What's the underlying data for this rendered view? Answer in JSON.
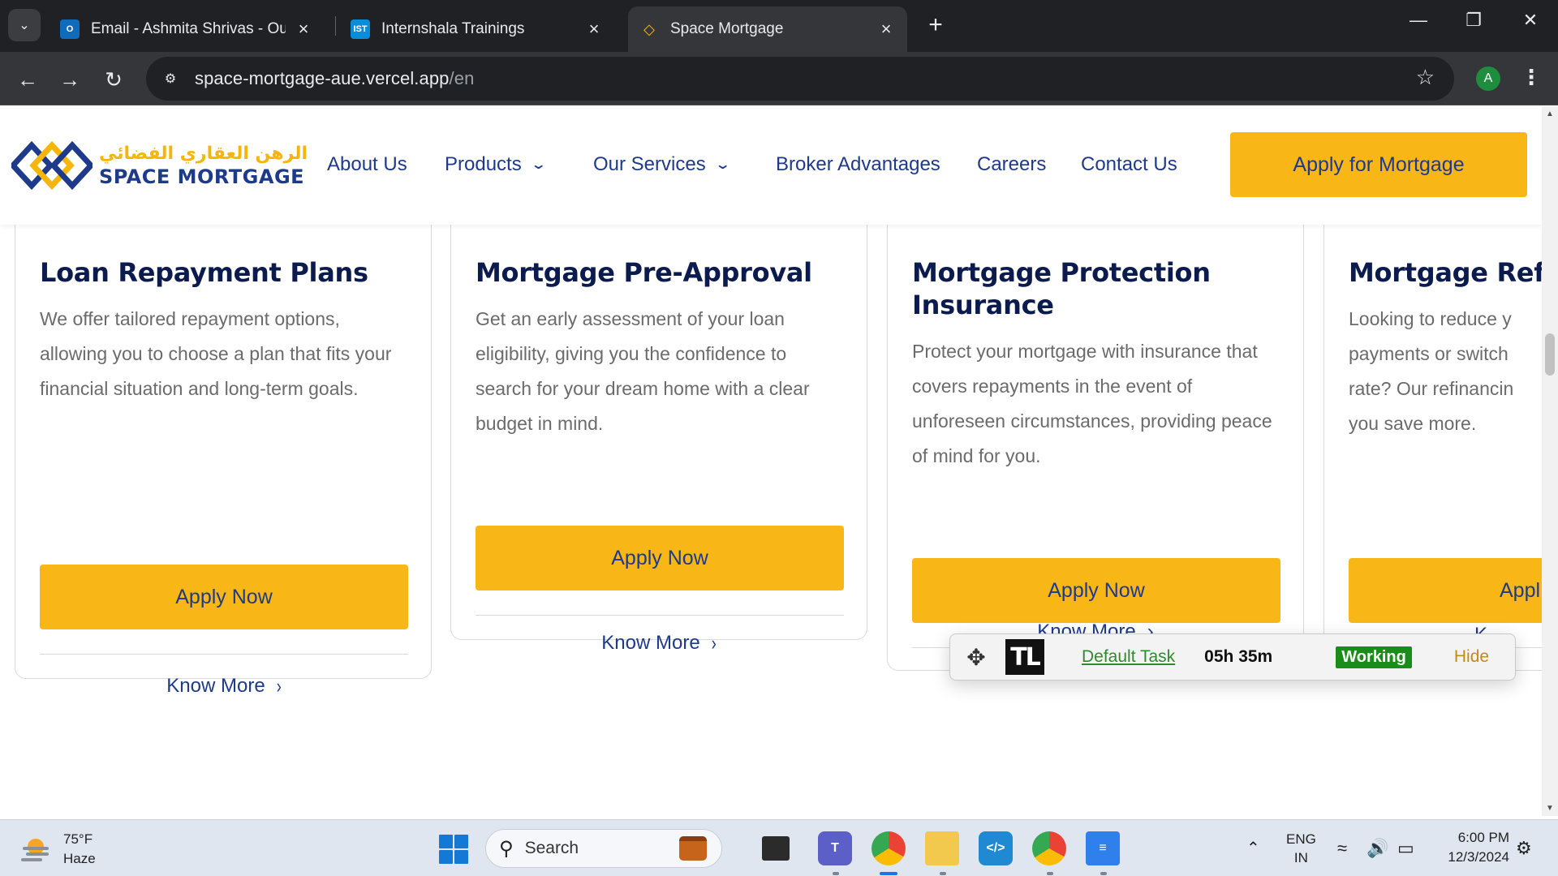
{
  "browser": {
    "tabs": [
      {
        "title": "Email - Ashmita Shrivas - Outlook",
        "icon": "outlook-icon",
        "active": false
      },
      {
        "title": "Internshala Trainings",
        "icon": "internshala-icon",
        "active": false
      },
      {
        "title": "Space Mortgage",
        "icon": "space-mortgage-favicon",
        "active": true
      }
    ],
    "url_host": "space-mortgage-aue.vercel.app",
    "url_path": "/en",
    "profile_initial": "A"
  },
  "site": {
    "logo_ar": "الرهن العقاري الفضائي",
    "logo_en": "SPACE MORTGAGE",
    "nav": {
      "about": "About Us",
      "products": "Products",
      "services": "Our Services",
      "broker": "Broker Advantages",
      "careers": "Careers",
      "contact": "Contact Us"
    },
    "cta": "Apply for Mortgage",
    "colors": {
      "brand_navy": "#1e3a8a",
      "brand_yellow": "#f8b716"
    }
  },
  "cards": [
    {
      "title": "Loan Repayment Plans",
      "text": "We offer tailored repayment options, allowing you to choose a plan that fits your financial situation and long-term goals.",
      "apply": "Apply Now",
      "more": "Know More"
    },
    {
      "title": "Mortgage Pre-Approval",
      "text": "Get an early assessment of your loan eligibility, giving you the confidence to search for your dream home with a clear budget in mind.",
      "apply": "Apply Now",
      "more": "Know More"
    },
    {
      "title": "Mortgage Protection Insurance",
      "text": "Protect your mortgage with insurance that covers repayments in the event of unforeseen circumstances, providing peace of mind for you.",
      "apply": "Apply Now",
      "more": "Know More"
    },
    {
      "title": "Mortgage Refi",
      "text": "Looking to reduce y payments or switch rate? Our refinancin you save more.",
      "apply": "Appl",
      "more": "K"
    }
  ],
  "tracker": {
    "logo": "TL",
    "task": "Default Task",
    "time": "05h 35m",
    "status": "Working",
    "hide": "Hide"
  },
  "taskbar": {
    "temp": "75°F",
    "condition": "Haze",
    "search": "Search",
    "lang_top": "ENG",
    "lang_bottom": "IN",
    "time": "6:00 PM",
    "date": "12/3/2024"
  }
}
